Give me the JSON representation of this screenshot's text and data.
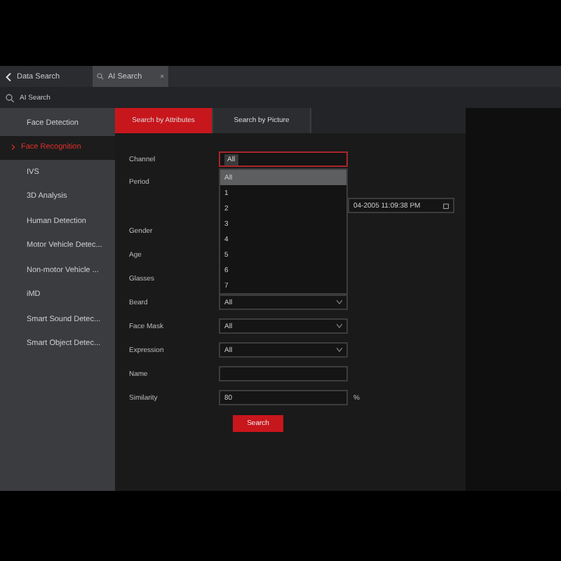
{
  "top_bar": {
    "back_label": "Data Search",
    "tabs": [
      {
        "label": "AI Search",
        "selected": true,
        "close": "×"
      }
    ]
  },
  "sub_bar": {
    "title": "AI Search"
  },
  "sidebar": {
    "items": [
      {
        "label": "Face Detection",
        "selected": false
      },
      {
        "label": "Face Recognition",
        "selected": true
      },
      {
        "label": "IVS",
        "selected": false
      },
      {
        "label": "3D Analysis",
        "selected": false
      },
      {
        "label": "Human Detection",
        "selected": false
      },
      {
        "label": "Motor Vehicle Detec...",
        "selected": false
      },
      {
        "label": "Non-motor Vehicle ...",
        "selected": false
      },
      {
        "label": "iMD",
        "selected": false
      },
      {
        "label": "Smart Sound Detec...",
        "selected": false
      },
      {
        "label": "Smart Object Detec...",
        "selected": false
      }
    ]
  },
  "tabs": [
    {
      "label": "Search by Attributes",
      "selected": true
    },
    {
      "label": "Search by Picture",
      "selected": false
    }
  ],
  "form": {
    "fields": [
      {
        "kind": "tags",
        "label": "Channel",
        "value": "All"
      },
      {
        "kind": "date",
        "label": "Period",
        "value": "04-2005 11:09:38 PM"
      },
      {
        "kind": "select",
        "label": "Gender"
      },
      {
        "kind": "select",
        "label": "Age"
      },
      {
        "kind": "select",
        "label": "Glasses"
      },
      {
        "kind": "select",
        "label": "Beard",
        "value": "All"
      },
      {
        "kind": "select",
        "label": "Face Mask",
        "value": "All"
      },
      {
        "kind": "select",
        "label": "Expression",
        "value": "All"
      },
      {
        "kind": "text",
        "label": "Name"
      },
      {
        "kind": "number",
        "label": "Similarity",
        "value": "80",
        "unit": "%"
      }
    ],
    "search_button": "Search"
  },
  "channel_dropdown": {
    "options": [
      {
        "label": "All",
        "selected": true
      },
      {
        "label": "1",
        "selected": false
      },
      {
        "label": "2",
        "selected": false
      },
      {
        "label": "3",
        "selected": false
      },
      {
        "label": "4",
        "selected": false
      },
      {
        "label": "5",
        "selected": false
      },
      {
        "label": "6",
        "selected": false
      },
      {
        "label": "7",
        "selected": false
      }
    ]
  }
}
